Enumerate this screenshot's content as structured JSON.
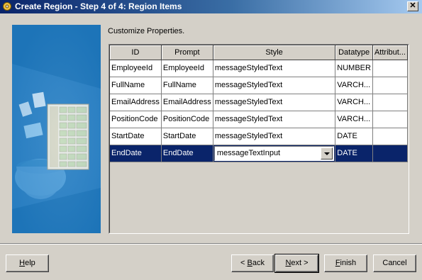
{
  "window": {
    "title": "Create Region - Step 4 of 4: Region Items",
    "close_glyph": "✕",
    "app_icon": "gear-icon"
  },
  "main": {
    "section_label": "Customize Properties."
  },
  "table": {
    "columns": [
      "ID",
      "Prompt",
      "Style",
      "Datatype",
      "Attribut..."
    ],
    "rows": [
      [
        "EmployeeId",
        "EmployeeId",
        "messageStyledText",
        "NUMBER",
        ""
      ],
      [
        "FullName",
        "FullName",
        "messageStyledText",
        "VARCH...",
        ""
      ],
      [
        "EmailAddress",
        "EmailAddress",
        "messageStyledText",
        "VARCH...",
        ""
      ],
      [
        "PositionCode",
        "PositionCode",
        "messageStyledText",
        "VARCH...",
        ""
      ],
      [
        "StartDate",
        "StartDate",
        "messageStyledText",
        "DATE",
        ""
      ],
      [
        "EndDate",
        "EndDate",
        "messageTextInput",
        "DATE",
        ""
      ]
    ],
    "selected_row": 5
  },
  "buttons": {
    "help": {
      "pre": "",
      "key": "H",
      "post": "elp"
    },
    "back": {
      "pre": "< ",
      "key": "B",
      "post": "ack"
    },
    "next": {
      "pre": "",
      "key": "N",
      "post": "ext >"
    },
    "finish": {
      "pre": "",
      "key": "F",
      "post": "inish"
    },
    "cancel": {
      "pre": "Cancel",
      "key": "",
      "post": ""
    }
  },
  "colors": {
    "title_bar": "#0a246a",
    "selection": "#0a246a",
    "dialog_bg": "#d4d0c8",
    "art_bg": "#1d74b8"
  }
}
